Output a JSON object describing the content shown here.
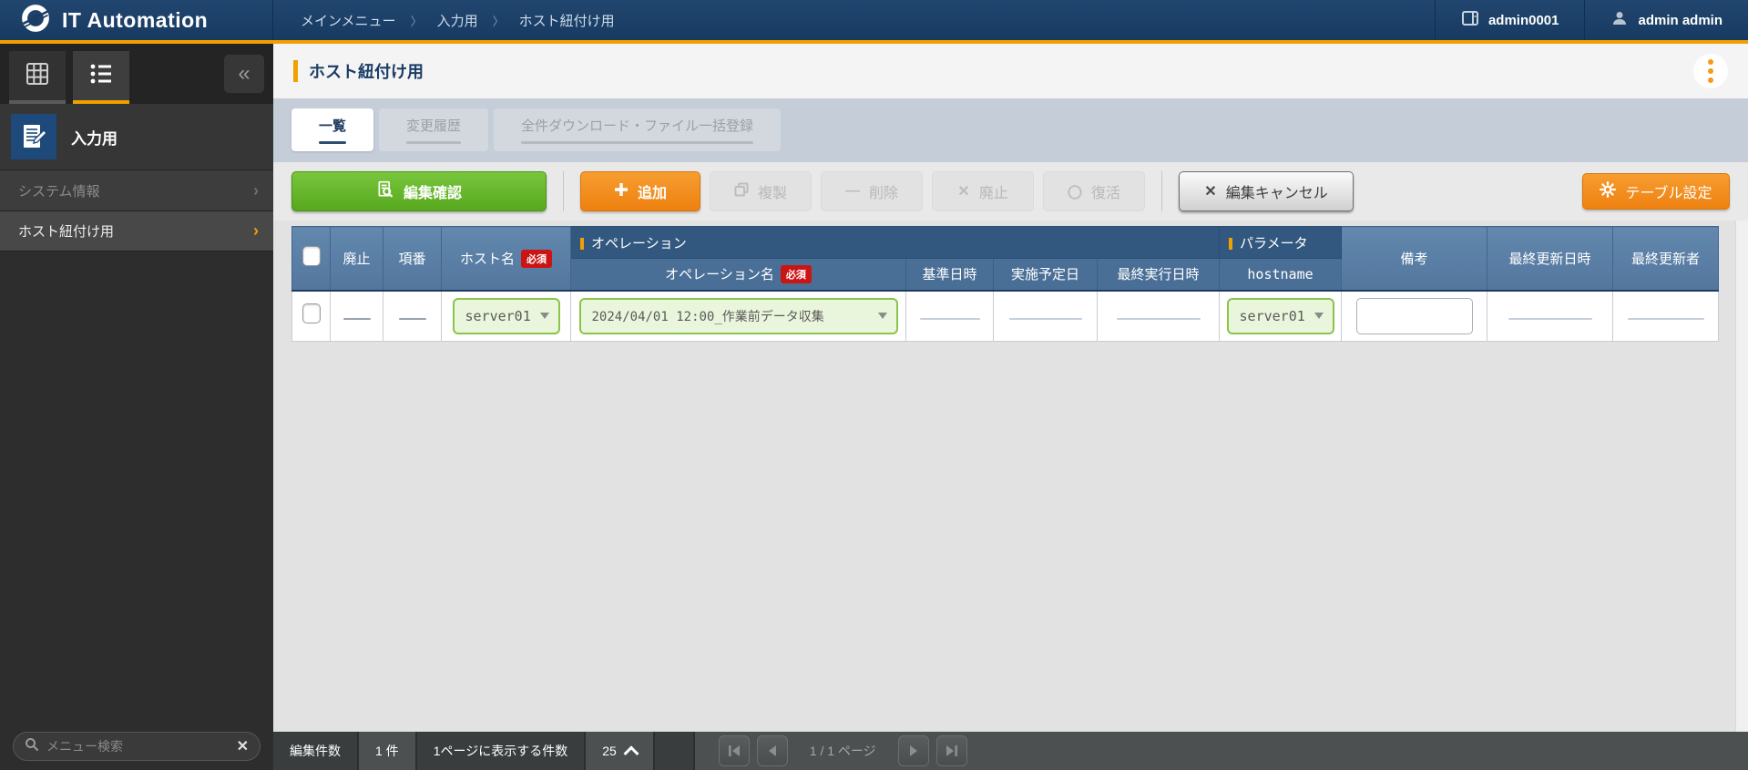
{
  "colors": {
    "accent_orange": "#f0a000",
    "header_navy": "#1c3d63",
    "table_header_blue": "#5b7da4",
    "green_button": "#62b52c",
    "orange_button": "#f28a1c",
    "required_red": "#cb1515",
    "select_green_bg": "#eaf6dc",
    "select_green_border": "#8ac44a"
  },
  "header": {
    "app_title": "IT Automation",
    "breadcrumb": [
      "メインメニュー",
      "入力用",
      "ホスト紐付け用"
    ],
    "breadcrumb_separator": "〉",
    "workspace": "admin0001",
    "user": "admin admin"
  },
  "sidebar": {
    "collapse_glyph": "«",
    "section_title": "入力用",
    "items": [
      {
        "label": "システム情報"
      },
      {
        "label": "ホスト紐付け用"
      }
    ],
    "search_placeholder": "メニュー検索",
    "clear_glyph": "✕"
  },
  "main": {
    "page_title": "ホスト紐付け用",
    "tabs": [
      {
        "label": "一覧"
      },
      {
        "label": "変更履歴"
      },
      {
        "label": "全件ダウンロード・ファイル一括登録"
      }
    ],
    "toolbar": {
      "edit_confirm": "編集確認",
      "add": "追加",
      "duplicate": "複製",
      "delete": "削除",
      "discard": "廃止",
      "restore": "復活",
      "edit_cancel": "編集キャンセル",
      "table_settings": "テーブル設定",
      "duplicate_glyph": "⧉",
      "delete_glyph": "—",
      "discard_glyph": "✕",
      "restore_glyph": "〇",
      "cancel_glyph": "✕"
    },
    "table": {
      "required_badge": "必須",
      "col_discard": "廃止",
      "col_number": "項番",
      "col_host": "ホスト名",
      "group_operation": "オペレーション",
      "col_operation_name": "オペレーション名",
      "col_base_datetime": "基準日時",
      "col_scheduled_date": "実施予定日",
      "col_last_run": "最終実行日時",
      "group_parameter": "パラメータ",
      "col_hostname": "hostname",
      "col_remarks": "備考",
      "col_last_updated": "最終更新日時",
      "col_updated_by": "最終更新者",
      "row": {
        "host": "server01",
        "operation": "2024/04/01 12:00_作業前データ収集",
        "hostname": "server01",
        "remarks": ""
      }
    },
    "footer": {
      "edit_count_label": "編集件数",
      "edit_count_value": "1 件",
      "per_page_label": "1ページに表示する件数",
      "per_page_value": "25",
      "page_info": "1 / 1 ページ"
    }
  }
}
